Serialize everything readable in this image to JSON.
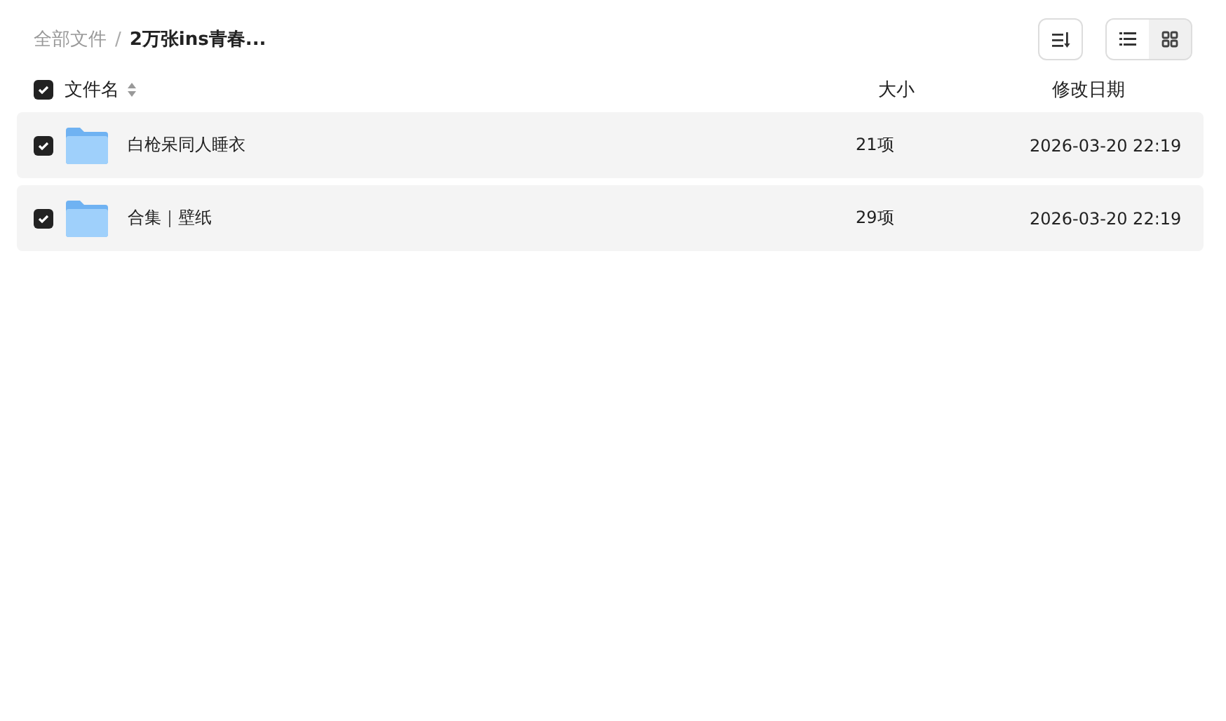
{
  "breadcrumb": [
    {
      "label": "全部文件",
      "current": false
    },
    {
      "label": "2万张ins青春...",
      "current": true
    }
  ],
  "separator": "/",
  "view_toggle": [
    {
      "kind": "list",
      "selected": true
    },
    {
      "kind": "grid",
      "selected": false
    }
  ],
  "table": {
    "select_all": {
      "checked": true
    },
    "columns": [
      "文件名",
      "大小",
      "修改日期"
    ],
    "rows": [
      {
        "name": "白枪呆同人睡衣",
        "size": "21项",
        "date": "2026-03-20 22:19",
        "checked": true
      },
      {
        "name": "合集｜壁纸",
        "size": "29项",
        "date": "2026-03-20 22:19",
        "checked": true
      }
    ]
  }
}
